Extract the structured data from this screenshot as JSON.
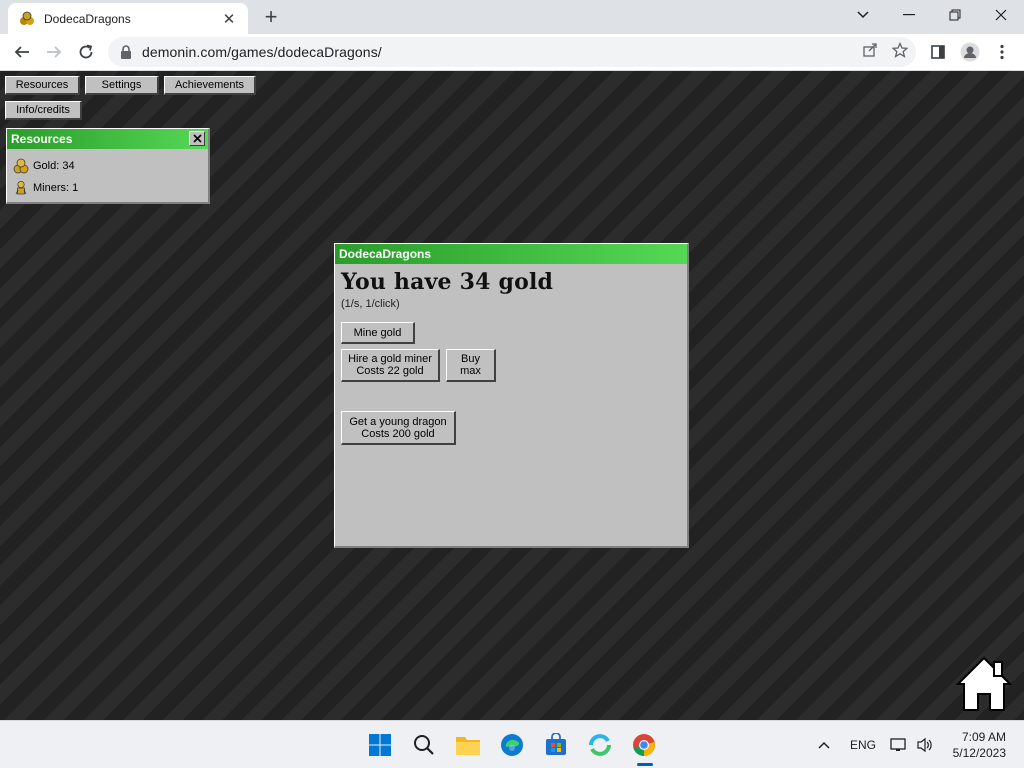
{
  "browser": {
    "tab_title": "DodecaDragons",
    "tab_close": "✕",
    "new_tab": "+",
    "url": "demonin.com/games/dodecaDragons/"
  },
  "menu": {
    "resources": "Resources",
    "settings": "Settings",
    "achievements": "Achievements",
    "info": "Info/credits"
  },
  "resources_panel": {
    "title": "Resources",
    "gold": "Gold: 34",
    "miners": "Miners: 1"
  },
  "main_window": {
    "title": "DodecaDragons",
    "heading": "You have 34 gold",
    "rate": "(1/s, 1/click)",
    "mine_button": "Mine gold",
    "hire_line1": "Hire a gold miner",
    "hire_line2": "Costs 22 gold",
    "buymax_line1": "Buy",
    "buymax_line2": "max",
    "dragon_line1": "Get a young dragon",
    "dragon_line2": "Costs 200 gold"
  },
  "taskbar": {
    "lang": "ENG",
    "time": "7:09 AM",
    "date": "5/12/2023"
  },
  "colors": {
    "title_green_dark": "#2a9c2a",
    "title_green_light": "#56d856",
    "panel_gray": "#c0c0c0"
  }
}
